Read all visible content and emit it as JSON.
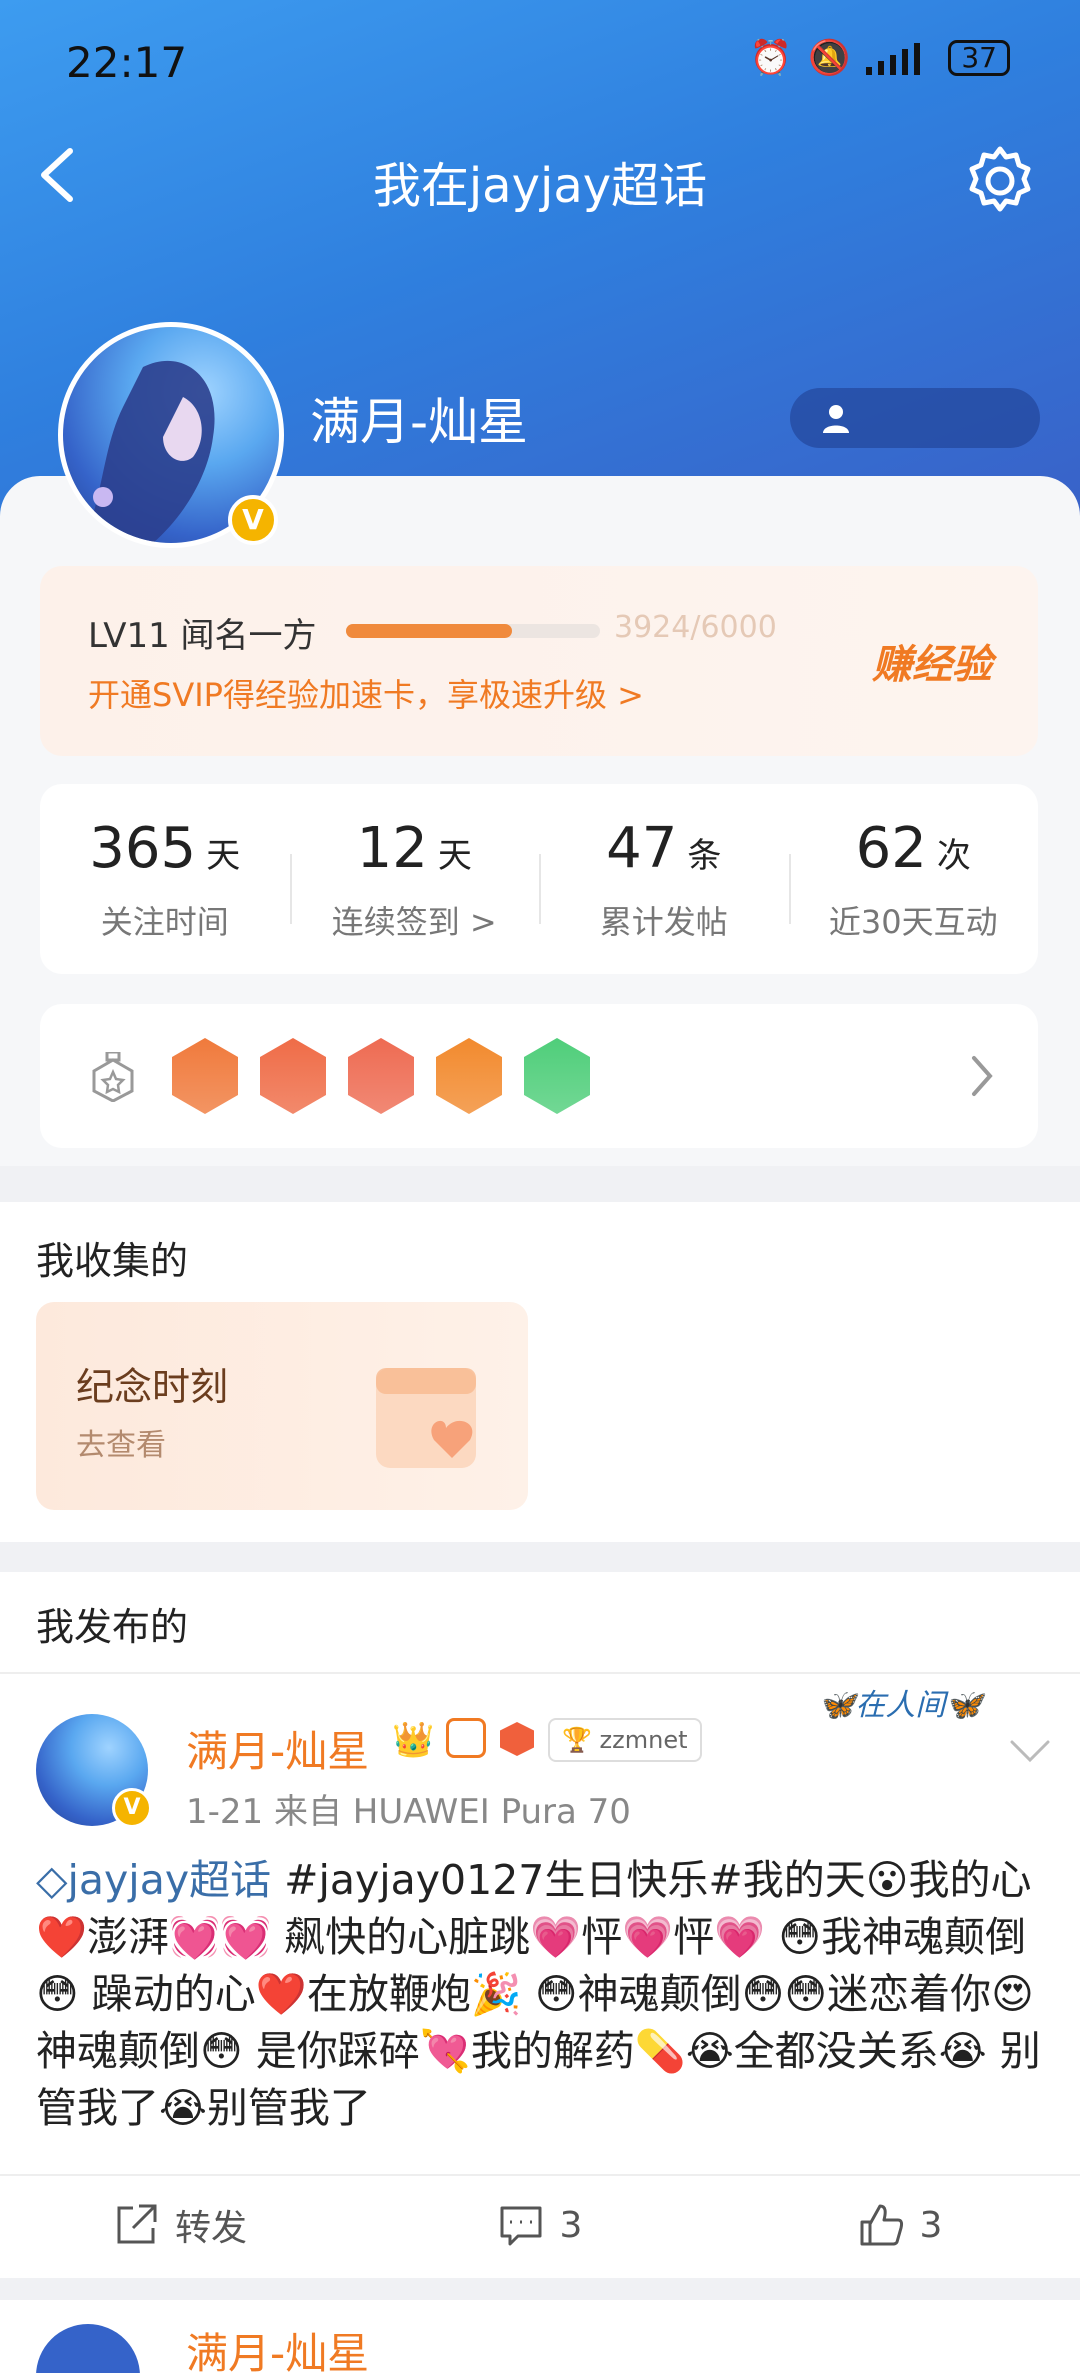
{
  "status_bar": {
    "time": "22:17",
    "battery": "37"
  },
  "header": {
    "title": "我在jayjay超话"
  },
  "profile": {
    "name": "满月-灿星",
    "verified_mark": "V"
  },
  "level": {
    "label": "LV11 闻名一方",
    "progress_text": "3924/6000",
    "progress": 0.654,
    "promo": "开通SVIP得经验加速卡，享极速升级 >",
    "earn": "赚经验"
  },
  "stats": [
    {
      "value": "365",
      "unit": "天",
      "label": "关注时间"
    },
    {
      "value": "12",
      "unit": "天",
      "label": "连续签到 >"
    },
    {
      "value": "47",
      "unit": "条",
      "label": "累计发帖"
    },
    {
      "value": "62",
      "unit": "次",
      "label": "近30天互动"
    }
  ],
  "medals": [
    {
      "color": "#f07a3c"
    },
    {
      "color": "#ef6c47"
    },
    {
      "color": "#ee6b52"
    },
    {
      "color": "#f28a2e"
    },
    {
      "color": "#4fce7a"
    }
  ],
  "collected": {
    "heading": "我收集的",
    "card_title": "纪念时刻",
    "card_sub": "去查看"
  },
  "published": {
    "heading": "我发布的"
  },
  "post": {
    "author": "满月-灿星",
    "tag": "zzmnet",
    "meta": "1-21  来自 HUAWEI Pura 70",
    "deco": "在人间",
    "topic": "jayjay超话",
    "body": "#jayjay0127生日快乐#我的天😮我的心❤️澎湃💓💓 飙快的心脏跳💗怦💗怦💗 😳我神魂颠倒😳 躁动的心❤️在放鞭炮🎉 😳神魂颠倒😳😳迷恋着你😍神魂颠倒😳 是你踩碎💘我的解药💊😭全都没关系😭 别管我了😭别管我了",
    "actions": {
      "forward": "转发",
      "comments": "3",
      "likes": "3"
    }
  },
  "next_post": {
    "author": "满月-灿星"
  }
}
